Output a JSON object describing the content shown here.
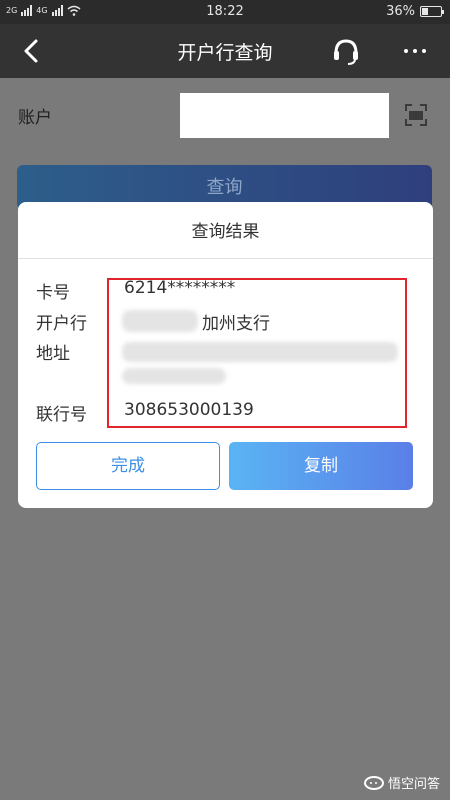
{
  "status_bar": {
    "network_1": "2G",
    "network_2": "4G",
    "time": "18:22",
    "battery_percent": "36%",
    "battery_level": 0.36
  },
  "nav": {
    "title": "开户行查询"
  },
  "form": {
    "account_label": "账户",
    "account_value": "",
    "query_button": "查询"
  },
  "dialog": {
    "title": "查询结果",
    "rows": [
      {
        "label": "卡号",
        "value": "6214********"
      },
      {
        "label": "开户行",
        "value": "加州支行"
      },
      {
        "label": "地址",
        "value": ""
      },
      {
        "label": "联行号",
        "value": "308653000139"
      }
    ],
    "done_button": "完成",
    "copy_button": "复制"
  },
  "watermark": {
    "text": "悟空问答"
  },
  "colors": {
    "accent": "#3d8fe6",
    "highlight_border": "#e0262c",
    "navbar": "#333333",
    "overlay": "#7a7a7a"
  }
}
